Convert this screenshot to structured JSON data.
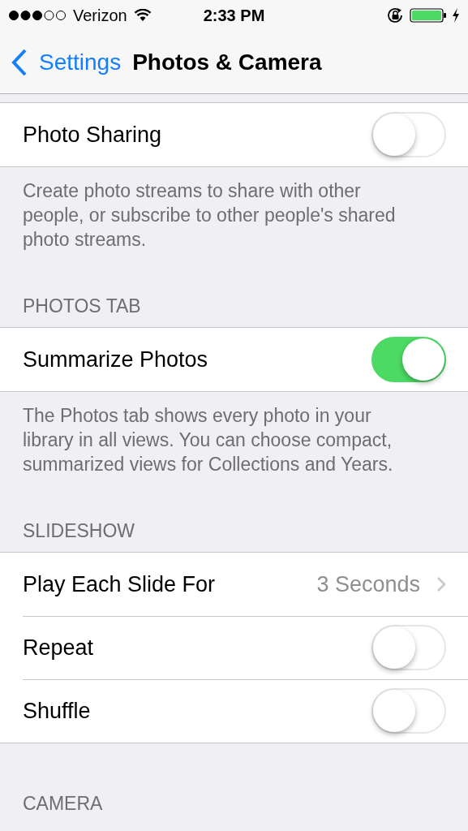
{
  "status_bar": {
    "carrier": "Verizon",
    "time": "2:33 PM"
  },
  "nav": {
    "back": "Settings",
    "title": "Photos & Camera"
  },
  "sections": [
    {
      "rows": [
        {
          "kind": "toggle",
          "label": "Photo Sharing",
          "on": false
        }
      ],
      "footer": "Create photo streams to share with other people, or subscribe to other people's shared photo streams."
    },
    {
      "header": "PHOTOS TAB",
      "rows": [
        {
          "kind": "toggle",
          "label": "Summarize Photos",
          "on": true
        }
      ],
      "footer": "The Photos tab shows every photo in your library in all views. You can choose compact, summarized views for Collections and Years."
    },
    {
      "header": "SLIDESHOW",
      "rows": [
        {
          "kind": "value",
          "label": "Play Each Slide For",
          "value": "3 Seconds"
        },
        {
          "kind": "toggle",
          "label": "Repeat",
          "on": false
        },
        {
          "kind": "toggle",
          "label": "Shuffle",
          "on": false
        }
      ]
    },
    {
      "header": "CAMERA"
    }
  ]
}
